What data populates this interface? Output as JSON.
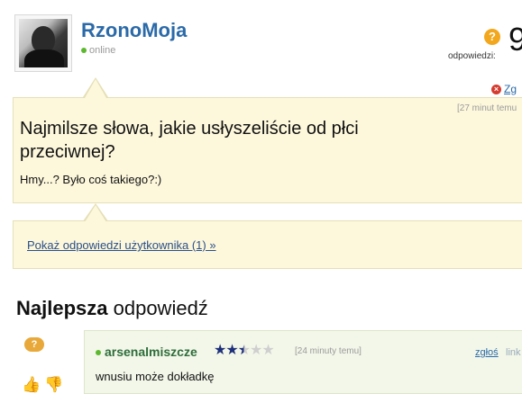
{
  "question_header": {
    "username": "RzonoMoja",
    "status": "online",
    "answers_label": "odpowiedzi:",
    "answers_count": "9",
    "report_label": "Zg",
    "time_ago": "[27 minut temu"
  },
  "question": {
    "title": "Najmilsze słowa, jakie usłyszeliście od płci przeciwnej?",
    "description": "Hmy...? Było coś takiego?:)"
  },
  "show_user_answers": "Pokaż odpowiedzi użytkownika (1) »",
  "best_answer_section": {
    "title_bold": "Najlepsza",
    "title_rest": " odpowiedź"
  },
  "best_answer": {
    "username": "arsenalmiszcze",
    "stars_filled": 2.5,
    "stars_total": 5,
    "time_ago": "[24 minuty temu]",
    "report_label": "zgłoś",
    "link_label": "link",
    "text": "wnusiu może dokładkę"
  },
  "colors": {
    "link_blue": "#2b6aa8",
    "bubble_bg": "#fdf8dc",
    "answer_bg": "#f3f7e9",
    "username_green": "#2e6d3b"
  },
  "icons": {
    "answers": "question-bubble-icon",
    "report": "close-icon",
    "best_answer": "best-answer-icon",
    "thumbs": "thumbs-up-down-icon"
  }
}
